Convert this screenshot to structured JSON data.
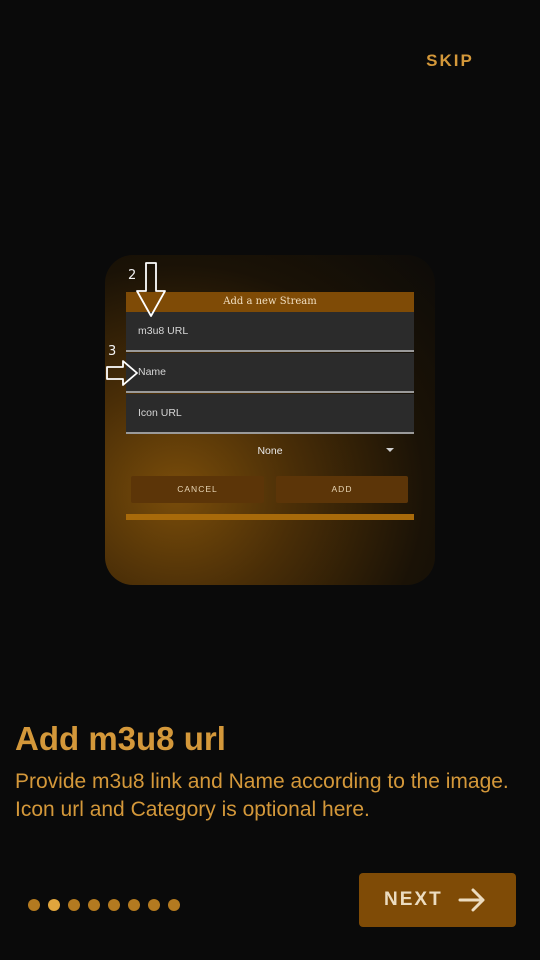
{
  "header": {
    "skip_label": "SKIP"
  },
  "illustration": {
    "dialog_title": "Add a new Stream",
    "fields": [
      {
        "placeholder": "m3u8 URL"
      },
      {
        "placeholder": "Name"
      },
      {
        "placeholder": "Icon URL"
      }
    ],
    "category_value": "None",
    "cancel_label": "CANCEL",
    "add_label": "ADD",
    "markers": [
      "2",
      "3"
    ]
  },
  "content": {
    "title": "Add m3u8 url",
    "description": "Provide m3u8 link and Name according to the image. Icon url and Category is optional here."
  },
  "pager": {
    "total": 8,
    "active_index": 1
  },
  "footer": {
    "next_label": "NEXT"
  },
  "colors": {
    "accent": "#d4983a",
    "button_bg": "#7f4b06",
    "background": "#0a0a0a"
  },
  "icons": {
    "next": "arrow-right-icon",
    "dropdown": "caret-down-icon"
  }
}
